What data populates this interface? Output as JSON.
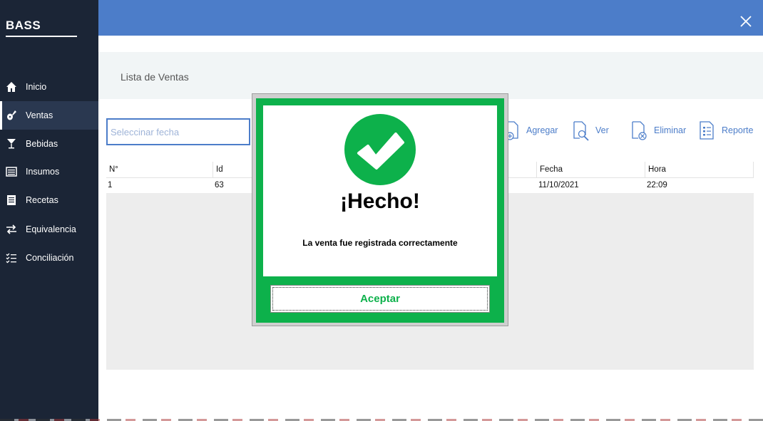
{
  "app": {
    "brand": "BASS"
  },
  "sidebar": {
    "items": [
      {
        "label": "Inicio",
        "icon": "home-icon"
      },
      {
        "label": "Ventas",
        "icon": "guitar-icon",
        "active": true
      },
      {
        "label": "Bebidas",
        "icon": "glass-icon"
      },
      {
        "label": "Insumos",
        "icon": "list-icon"
      },
      {
        "label": "Recetas",
        "icon": "recipe-icon"
      },
      {
        "label": "Equivalencia",
        "icon": "swap-icon"
      },
      {
        "label": "Conciliación",
        "icon": "checklist-icon"
      }
    ]
  },
  "header": {
    "title": "Lista de Ventas"
  },
  "search": {
    "placeholder": "Seleccinar fecha"
  },
  "toolbar": {
    "add_label": "Agregar",
    "view_label": "Ver",
    "delete_label": "Eliminar",
    "report_label": "Reporte"
  },
  "table": {
    "columns": [
      "N°",
      "Id",
      "Fecha",
      "Hora"
    ],
    "rows": [
      {
        "n": "1",
        "id": "63",
        "fecha": "11/10/2021",
        "hora": "22:09"
      }
    ]
  },
  "dialog": {
    "title": "¡Hecho!",
    "message": "La venta fue registrada correctamente",
    "button_label": "Aceptar"
  },
  "colors": {
    "sidebar": "#1b2536",
    "topbar": "#4c7dc9",
    "success": "#0db14b"
  }
}
